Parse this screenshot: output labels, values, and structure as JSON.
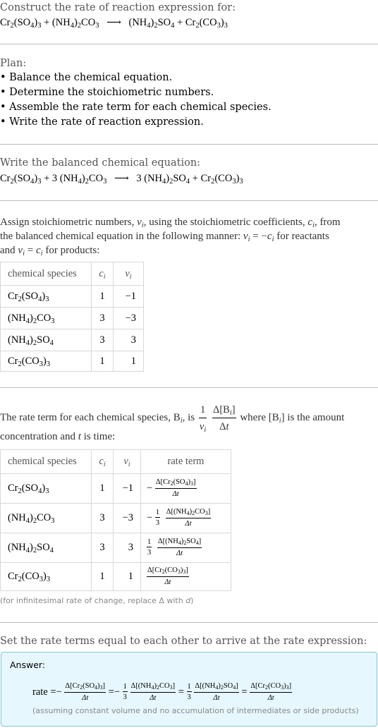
{
  "intro": {
    "heading": "Construct the rate of reaction expression for:",
    "reaction": {
      "reactants": [
        {
          "parts": [
            "Cr",
            {
              "sub": "2"
            },
            "(SO",
            {
              "sub": "4"
            },
            ")",
            {
              "sub": "3"
            }
          ]
        },
        {
          "parts": [
            "(NH",
            {
              "sub": "4"
            },
            ")",
            {
              "sub": "2"
            },
            "CO",
            {
              "sub": "3"
            }
          ]
        }
      ],
      "products": [
        {
          "parts": [
            "(NH",
            {
              "sub": "4"
            },
            ")",
            {
              "sub": "2"
            },
            "SO",
            {
              "sub": "4"
            }
          ]
        },
        {
          "parts": [
            "Cr",
            {
              "sub": "2"
            },
            "(CO",
            {
              "sub": "3"
            },
            ")",
            {
              "sub": "3"
            }
          ]
        }
      ],
      "plus": "+",
      "arrow": "⟶"
    }
  },
  "plan": {
    "heading": "Plan:",
    "bullet": "•",
    "steps": [
      "Balance the chemical equation.",
      "Determine the stoichiometric numbers.",
      "Assemble the rate term for each chemical species.",
      "Write the rate of reaction expression."
    ]
  },
  "balanced": {
    "heading": "Write the balanced chemical equation:",
    "coefficients": [
      "",
      "3",
      "3",
      ""
    ]
  },
  "assign": {
    "line1": "Assign stoichiometric numbers, ",
    "nu_i": "ν",
    "i": "i",
    "line1b": ", using the stoichiometric coefficients, ",
    "c_i": "c",
    "line1c": ", from",
    "line2a": "the balanced chemical equation in the following manner: ",
    "eq_reactants": " = −",
    "line2b": " for reactants",
    "line3a": "and ",
    "eq_products": " = ",
    "line3b": " for products:"
  },
  "table1": {
    "headers": [
      "chemical species",
      "c",
      "ν"
    ],
    "header_sub": "i",
    "rows": [
      {
        "c": "1",
        "nu": "−1"
      },
      {
        "c": "3",
        "nu": "−3"
      },
      {
        "c": "3",
        "nu": "3"
      },
      {
        "c": "1",
        "nu": "1"
      }
    ]
  },
  "rate_term_intro": {
    "part1": "The rate term for each chemical species, B",
    "part1b": ", is ",
    "one": "1",
    "delta_B": "Δ[B",
    "delta_t": "Δ",
    "t": "t",
    "part2": " where [B",
    "part2b": "] is the amount",
    "line2a": "concentration and ",
    "line2b": " is time:"
  },
  "table2": {
    "headers": [
      "chemical species",
      "c",
      "ν",
      "rate term"
    ],
    "rows": [
      {
        "c": "1",
        "nu": "−1",
        "sign": "−",
        "coef": ""
      },
      {
        "c": "3",
        "nu": "−3",
        "sign": "−",
        "coef": "3"
      },
      {
        "c": "3",
        "nu": "3",
        "sign": "",
        "coef": "3"
      },
      {
        "c": "1",
        "nu": "1",
        "sign": "",
        "coef": ""
      }
    ],
    "delta": "Δ",
    "dt": "Δt",
    "one": "1"
  },
  "footnote": {
    "text_a": "(for infinitesimal rate of change, replace Δ with ",
    "d": "d",
    "text_b": ")"
  },
  "final": {
    "heading": "Set the rate terms equal to each other to arrive at the rate expression:",
    "answer_label": "Answer:",
    "rate_label": "rate",
    "equals": "=",
    "assumption": "(assuming constant volume and no accumulation of intermediates or side products)"
  }
}
